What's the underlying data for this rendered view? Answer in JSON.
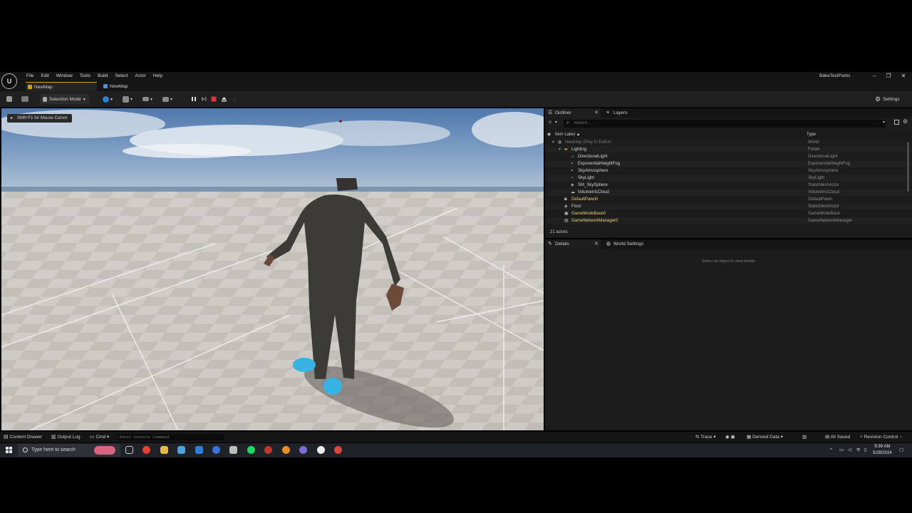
{
  "menubar": {
    "items": [
      "File",
      "Edit",
      "Window",
      "Tools",
      "Build",
      "Select",
      "Actor",
      "Help"
    ],
    "project_name": "BakeTestPants",
    "window_buttons": [
      "–",
      "❐",
      "✕"
    ]
  },
  "tabs": [
    {
      "label": "NewMap",
      "active": true
    },
    {
      "label": "NewMap",
      "active": false
    }
  ],
  "toolbar": {
    "selection_mode": "Selection Mode",
    "settings_label": "Settings"
  },
  "viewport": {
    "hint": "Shift+F1 for Mouse Cursor"
  },
  "outliner": {
    "tabs": [
      "Outliner",
      "Layers"
    ],
    "search_placeholder": "Search...",
    "columns": {
      "label": "Item Label ▲",
      "type": "Type"
    },
    "rows": [
      {
        "label": "NewMap (Play In Editor)",
        "type": "World",
        "indent": 0,
        "icon": "world-icon",
        "dim": true
      },
      {
        "label": "Lighting",
        "type": "Folder",
        "indent": 1,
        "icon": "folder-icon",
        "dim": false
      },
      {
        "label": "DirectionalLight",
        "type": "DirectionalLight",
        "indent": 2,
        "icon": "directional-light-icon",
        "dim": false
      },
      {
        "label": "ExponentialHeightFog",
        "type": "ExponentialHeightFog",
        "indent": 2,
        "icon": "fog-icon",
        "dim": false
      },
      {
        "label": "SkyAtmosphere",
        "type": "SkyAtmosphere",
        "indent": 2,
        "icon": "sky-atmosphere-icon",
        "dim": false
      },
      {
        "label": "SkyLight",
        "type": "SkyLight",
        "indent": 2,
        "icon": "skylight-icon",
        "dim": false
      },
      {
        "label": "SM_SkySphere",
        "type": "StaticMeshActor",
        "indent": 2,
        "icon": "static-mesh-icon",
        "dim": false
      },
      {
        "label": "VolumetricCloud",
        "type": "VolumetricCloud",
        "indent": 2,
        "icon": "cloud-icon",
        "dim": false
      },
      {
        "label": "DefaultPawn0",
        "type": "DefaultPawn",
        "indent": 1,
        "icon": "pawn-icon",
        "dim": false,
        "yellow": true
      },
      {
        "label": "Floor",
        "type": "StaticMeshActor",
        "indent": 1,
        "icon": "static-mesh-icon",
        "dim": false
      },
      {
        "label": "GameModeBase0",
        "type": "GameModeBase",
        "indent": 1,
        "icon": "game-mode-icon",
        "dim": false,
        "yellow": true
      },
      {
        "label": "GameNetworkManager0",
        "type": "GameNetworkManager",
        "indent": 1,
        "icon": "network-icon",
        "dim": false,
        "yellow": true
      }
    ],
    "actor_count": "21 actors"
  },
  "details": {
    "tabs": [
      "Details",
      "World Settings"
    ],
    "empty_text": "Select an object to view details"
  },
  "statusbar": {
    "content_drawer": "Content Drawer",
    "output_log": "Output Log",
    "cmd": "Cmd",
    "console_placeholder": "Enter Console Command",
    "trace": "Trace",
    "derived_data": "Derived Data",
    "all_saved": "All Saved",
    "revision_control": "Revision Control"
  },
  "taskbar": {
    "search_placeholder": "Type here to search",
    "time": "9:39 AM",
    "date": "5/28/2024"
  },
  "colors": {
    "accent_tab": "#d6a300",
    "stop_button": "#e0303b",
    "yellow_actor": "#e8d27a",
    "sky": "#5f86b8",
    "shoes": "#3ab4e4"
  }
}
